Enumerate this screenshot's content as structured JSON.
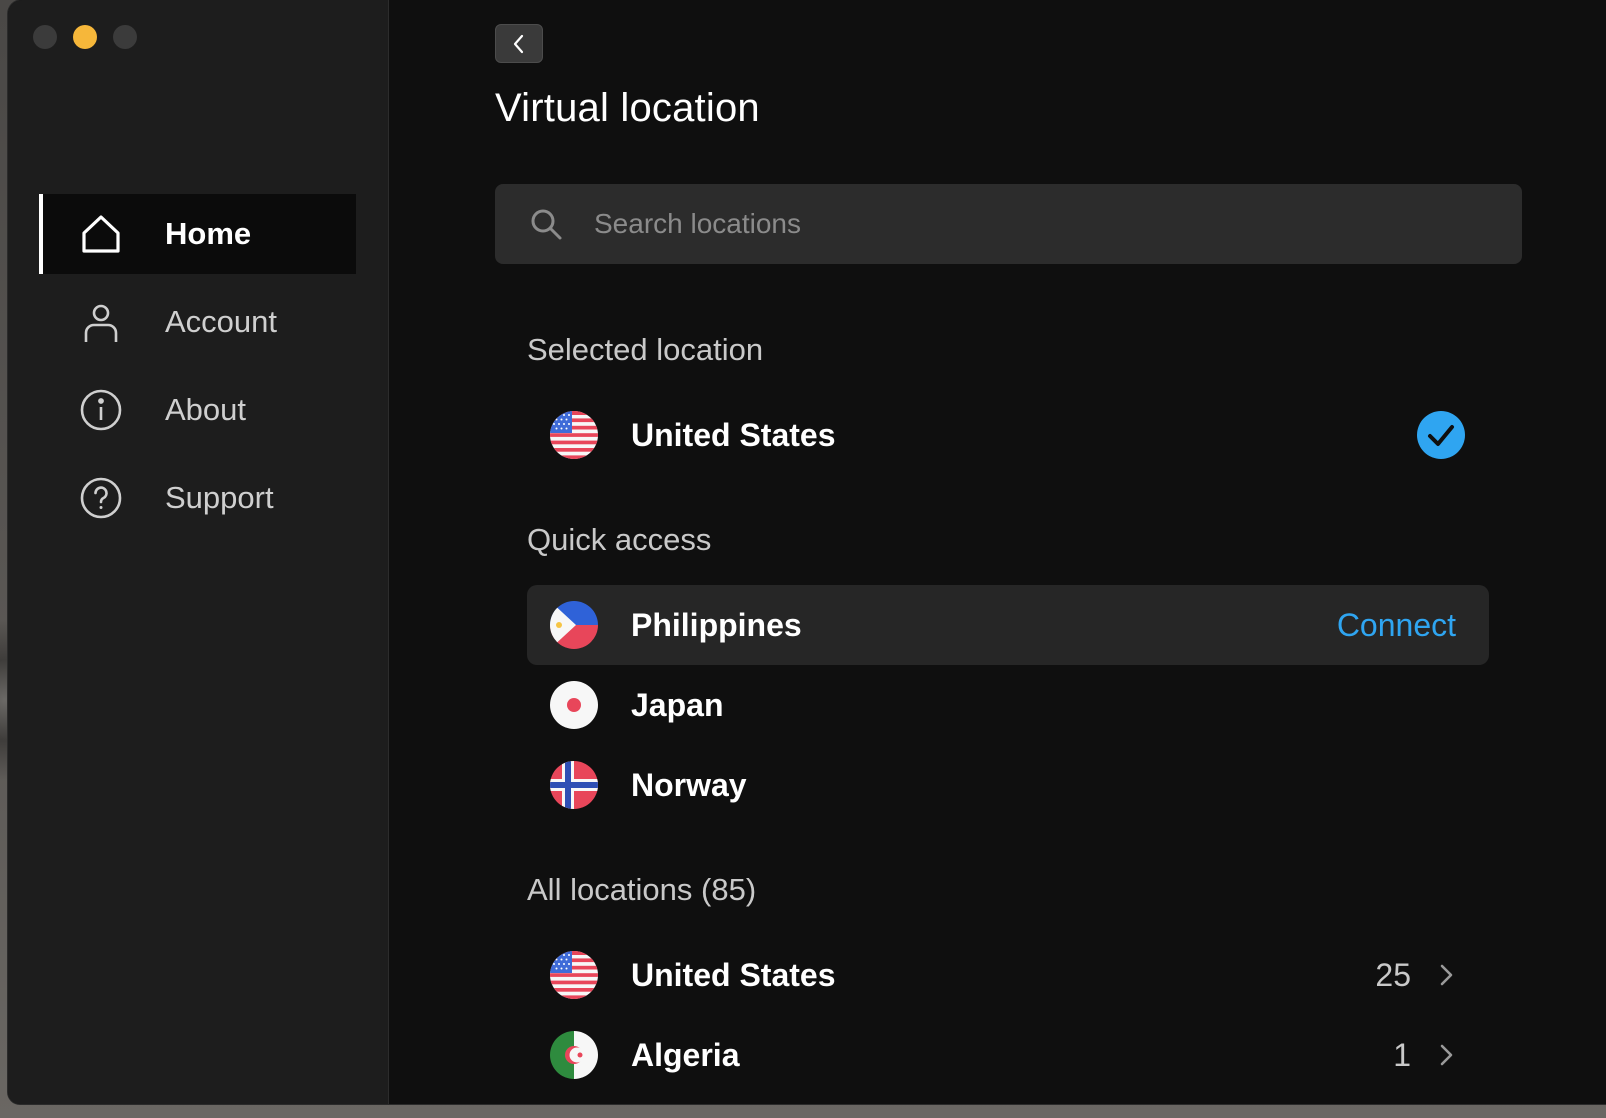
{
  "window": {
    "traffic_lights": [
      "close",
      "minimize",
      "zoom"
    ]
  },
  "sidebar": {
    "items": [
      {
        "label": "Home",
        "icon": "home-icon",
        "active": true
      },
      {
        "label": "Account",
        "icon": "person-icon",
        "active": false
      },
      {
        "label": "About",
        "icon": "info-icon",
        "active": false
      },
      {
        "label": "Support",
        "icon": "help-icon",
        "active": false
      }
    ]
  },
  "main": {
    "back_icon": "chevron-left-icon",
    "title": "Virtual location",
    "search": {
      "placeholder": "Search locations",
      "value": "",
      "icon": "search-icon"
    },
    "selected": {
      "heading": "Selected location",
      "location": {
        "name": "United States",
        "flag": "us-flag-icon",
        "status_icon": "checkmark-icon"
      }
    },
    "quick_access": {
      "heading": "Quick access",
      "items": [
        {
          "name": "Philippines",
          "flag": "ph-flag-icon",
          "action": "Connect"
        },
        {
          "name": "Japan",
          "flag": "jp-flag-icon"
        },
        {
          "name": "Norway",
          "flag": "no-flag-icon"
        }
      ]
    },
    "all_locations": {
      "heading": "All locations (85)",
      "items": [
        {
          "name": "United States",
          "flag": "us-flag-icon",
          "count": "25"
        },
        {
          "name": "Algeria",
          "flag": "dz-flag-icon",
          "count": "1"
        }
      ]
    }
  },
  "colors": {
    "accent": "#2fa5f1",
    "minimize": "#f6b73a",
    "background": "#0f0f0f",
    "sidebar": "#1d1d1d"
  }
}
